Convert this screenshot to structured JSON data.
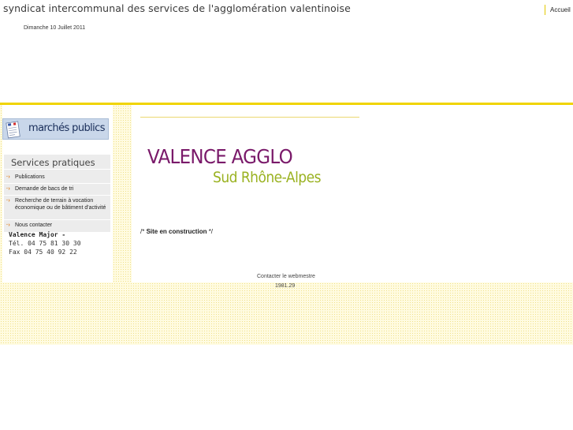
{
  "header": {
    "site_title": "syndicat intercommunal des services de l'agglomération valentinoise",
    "home_link": "Accueil",
    "date": "Dimanche 10 Juillet 2011"
  },
  "sidebar": {
    "banner_label": "marchés publics",
    "banner_icon": "document-icon",
    "services_title": "Services pratiques",
    "items": [
      {
        "label": "Publications"
      },
      {
        "label": "Demande de bacs de tri"
      },
      {
        "label": "Recherche de terrain à vocation économique ou de bâtiment d'activité"
      },
      {
        "label": "Nous contacter"
      }
    ],
    "contact": {
      "name": "Valence Major -",
      "phone": "Tél. 04 75 81 30 30",
      "fax": "Fax 04 75 40 92 22"
    }
  },
  "main": {
    "logo_title": "VALENCE AGGLO",
    "logo_subtitle": "Sud Rhône-Alpes",
    "construction_prefix": "/* ",
    "construction_bold": "Site en construction",
    "construction_suffix": " */",
    "webmaster_link": "Contacter le webmestre",
    "counter": "1981.29"
  },
  "colors": {
    "accent_yellow": "#f0d400",
    "logo_purple": "#7a1a6a",
    "logo_green": "#9ab221",
    "banner_blue": "#c9d7ea",
    "arrow_orange": "#e08020"
  }
}
